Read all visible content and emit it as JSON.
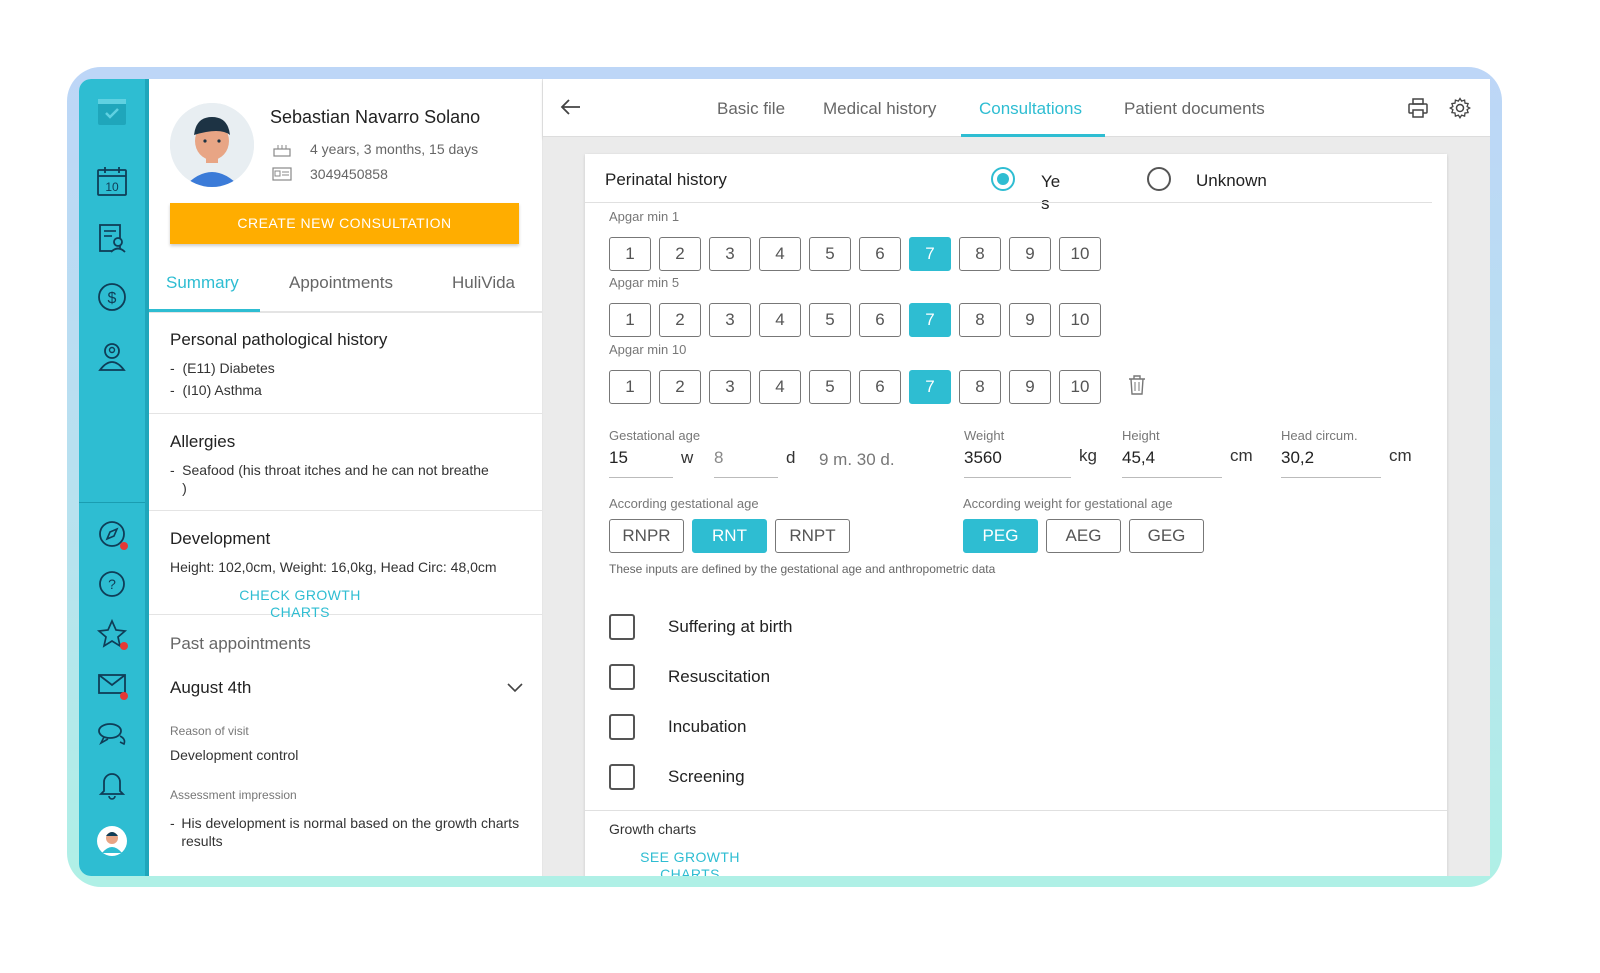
{
  "colors": {
    "accent": "#2ebdd2",
    "create_button": "#ffad00",
    "alert_dot": "#e53935"
  },
  "sidebar": {
    "top_items": [
      "check-icon",
      "calendar-icon",
      "patient-file-icon",
      "dollar-icon",
      "doctor-icon"
    ],
    "calendar_day": "10",
    "bottom_items": [
      "compass-icon",
      "help-icon",
      "star-icon",
      "mail-icon",
      "chat-icon",
      "bell-icon",
      "user-avatar"
    ]
  },
  "patient": {
    "name": "Sebastian Navarro Solano",
    "age": "4 years, 3 months, 15 days",
    "id_number": "3049450858",
    "create_button": "CREATE NEW CONSULTATION",
    "tabs": [
      "Summary",
      "Appointments",
      "HuliVida"
    ],
    "pathological": {
      "title": "Personal pathological history",
      "items": [
        "(E11) Diabetes",
        "(I10) Asthma"
      ]
    },
    "allergies": {
      "title": "Allergies",
      "items": [
        "Seafood (his throat itches and he can not breathe )"
      ]
    },
    "development": {
      "title": "Development",
      "text": "Height: 102,0cm, Weight: 16,0kg, Head Circ: 48,0cm",
      "link": "CHECK GROWTH CHARTS"
    },
    "past": {
      "title": "Past appointments",
      "date": "August 4th",
      "reason_label": "Reason of visit",
      "reason": "Development control",
      "impression_label": "Assessment impression",
      "impression": "His development is normal based on the growth charts results"
    }
  },
  "header": {
    "tabs": [
      "Basic file",
      "Medical history",
      "Consultations",
      "Patient documents"
    ],
    "active_tab": "Consultations"
  },
  "perinatal": {
    "title": "Perinatal history",
    "yes_label": "Ye s",
    "unknown_label": "Unknown",
    "selected": "Yes",
    "apgar": [
      {
        "label": "Apgar min 1",
        "selected": 7
      },
      {
        "label": "Apgar min 5",
        "selected": 7
      },
      {
        "label": "Apgar min 10",
        "selected": 7
      }
    ],
    "scale": [
      "1",
      "2",
      "3",
      "4",
      "5",
      "6",
      "7",
      "8",
      "9",
      "10"
    ],
    "gestational": {
      "label": "Gestational age",
      "weeks": "15",
      "w": "w",
      "days": "8",
      "d": "d",
      "summary": "9 m. 30 d."
    },
    "weight": {
      "label": "Weight",
      "value": "3560",
      "unit": "kg"
    },
    "height": {
      "label": "Height",
      "value": "45,4",
      "unit": "cm"
    },
    "head": {
      "label": "Head circum.",
      "value": "30,2",
      "unit": "cm"
    },
    "according_age": {
      "label": "According gestational age",
      "options": [
        "RNPR",
        "RNT",
        "RNPT"
      ],
      "selected": "RNT"
    },
    "according_weight": {
      "label": "According weight for gestational age",
      "options": [
        "PEG",
        "AEG",
        "GEG"
      ],
      "selected": "PEG"
    },
    "note": "These inputs are defined by the gestational age and anthropometric data",
    "checks": [
      "Suffering at birth",
      "Resuscitation",
      "Incubation",
      "Screening"
    ],
    "growth": {
      "label": "Growth charts",
      "link": "SEE GROWTH CHARTS"
    }
  }
}
